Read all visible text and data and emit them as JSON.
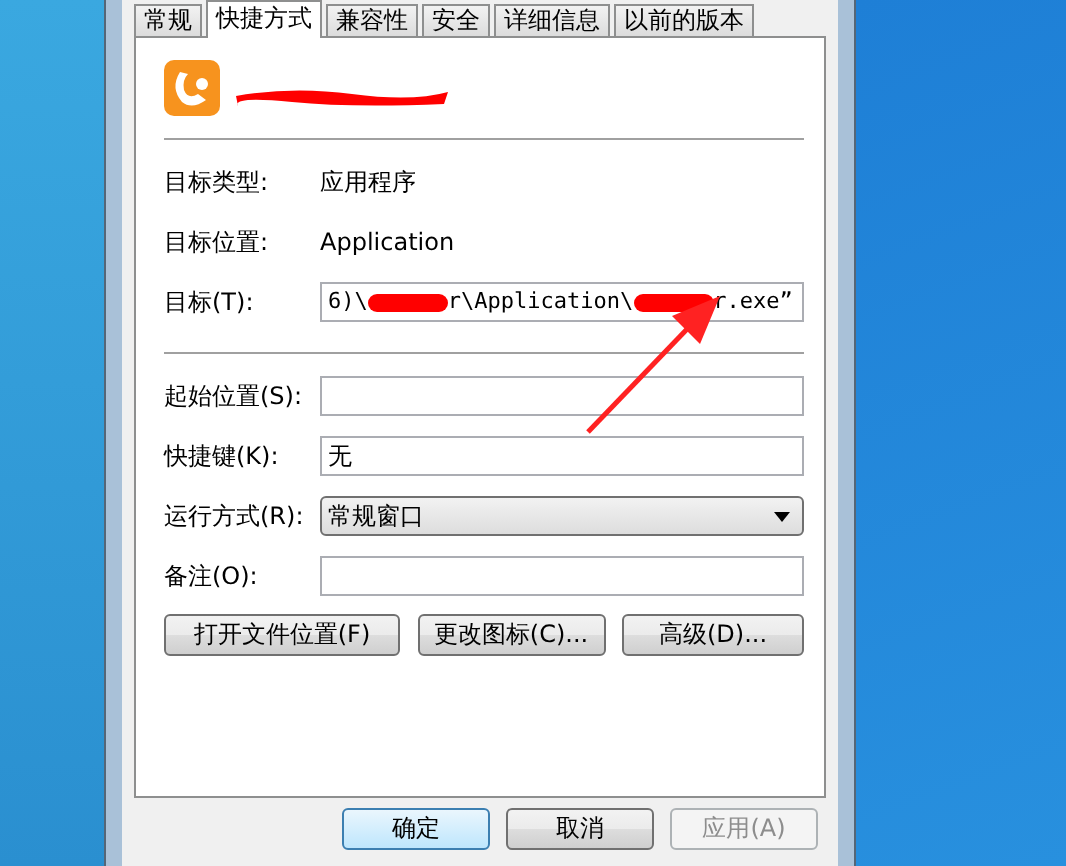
{
  "tabs": [
    {
      "label": "常规",
      "selected": false
    },
    {
      "label": "快捷方式",
      "selected": true
    },
    {
      "label": "兼容性",
      "selected": false
    },
    {
      "label": "安全",
      "selected": false
    },
    {
      "label": "详细信息",
      "selected": false
    },
    {
      "label": "以前的版本",
      "selected": false
    }
  ],
  "properties": [
    {
      "label": "目标类型:",
      "value": "应用程序"
    },
    {
      "label": "目标位置:",
      "value": "Application"
    }
  ],
  "target": {
    "label": "目标(T):",
    "value_parts": [
      "6)\\",
      "r\\Application\\",
      "r.exe”"
    ]
  },
  "fields": [
    {
      "kind": "text",
      "label": "起始位置(S):"
    },
    {
      "kind": "text",
      "label": "快捷键(K):",
      "value": "无"
    },
    {
      "kind": "dropdown",
      "label": "运行方式(R):",
      "value": "常规窗口"
    },
    {
      "kind": "text",
      "label": "备注(O):"
    }
  ],
  "buttons": [
    "打开文件位置(F)",
    "更改图标(C)...",
    "高级(D)..."
  ],
  "footer_buttons": [
    {
      "label": "确定",
      "disabled": false,
      "default": true
    },
    {
      "label": "取消",
      "disabled": false,
      "default": false
    },
    {
      "label": "应用(A)",
      "disabled": true,
      "default": false
    }
  ]
}
